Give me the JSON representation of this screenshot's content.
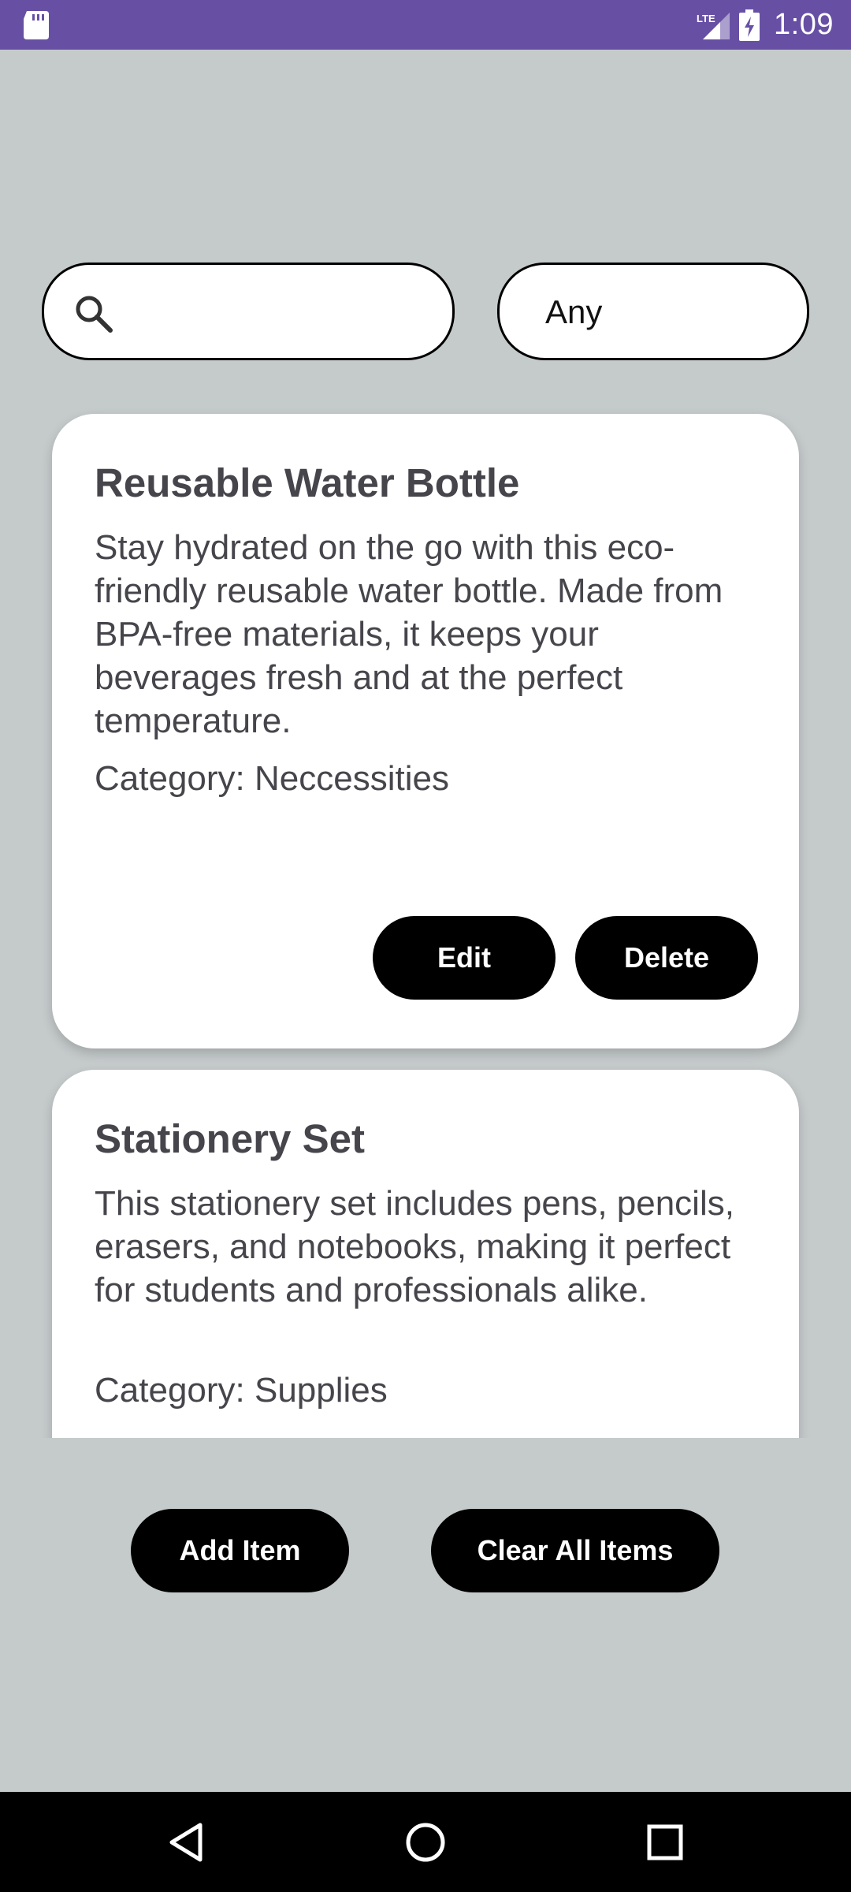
{
  "status_bar": {
    "time": "1:09",
    "network_label": "LTE",
    "background_color": "#6750a4",
    "icons": [
      "sd-card-icon",
      "lte-signal-icon",
      "battery-charging-icon"
    ]
  },
  "search": {
    "value": "",
    "placeholder": "",
    "icon": "search-icon"
  },
  "filter": {
    "selected": "Any"
  },
  "items": [
    {
      "title": "Reusable Water Bottle",
      "description": "Stay hydrated on the go with this eco-friendly reusable water bottle. Made from BPA-free materials, it keeps your beverages fresh and at the perfect temperature.",
      "category": "Category: Neccessities",
      "edit_label": "Edit",
      "delete_label": "Delete"
    },
    {
      "title": "Stationery Set",
      "description": "This stationery set includes pens, pencils, erasers, and notebooks, making it perfect for students and professionals alike.",
      "category": "Category: Supplies"
    }
  ],
  "actions": {
    "add_label": "Add Item",
    "clear_label": "Clear All Items"
  },
  "nav_bar": {
    "icons": [
      "back-icon",
      "home-icon",
      "recents-icon"
    ]
  },
  "colors": {
    "background": "#c5cacb",
    "card": "#ffffff",
    "button": "#000000",
    "text": "#46454b"
  }
}
